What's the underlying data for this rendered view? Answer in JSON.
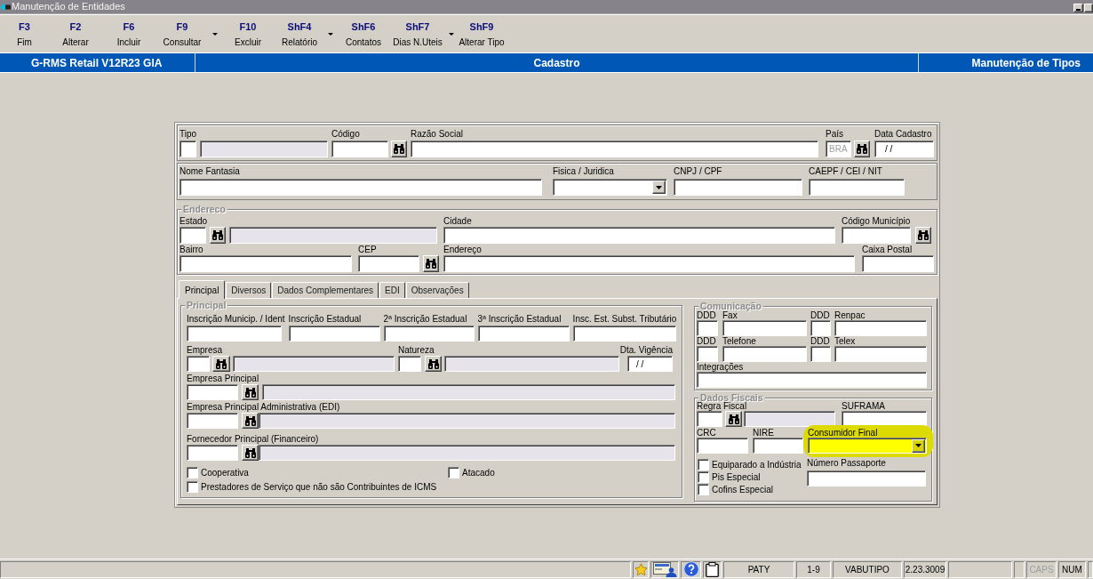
{
  "window": {
    "title": "Manutenção de Entidades"
  },
  "toolbar": [
    {
      "key": "F3",
      "label": "Fim",
      "menu": false
    },
    {
      "key": "F2",
      "label": "Alterar",
      "menu": false
    },
    {
      "key": "F6",
      "label": "Incluir",
      "menu": false
    },
    {
      "key": "F9",
      "label": "Consultar",
      "menu": true
    },
    {
      "key": "F10",
      "label": "Excluir",
      "menu": false
    },
    {
      "key": "ShF4",
      "label": "Relatório",
      "menu": true
    },
    {
      "key": "ShF6",
      "label": "Contatos",
      "menu": false
    },
    {
      "key": "ShF7",
      "label": "Dias N.Uteis",
      "menu": true
    },
    {
      "key": "ShF9",
      "label": "Alterar Tipo",
      "menu": false
    }
  ],
  "header_bar": {
    "system": "G-RMS Retail V12R23 GIA",
    "module": "Cadastro",
    "screen": "Manutenção de Tipos"
  },
  "identification": {
    "tipo": {
      "label": "Tipo"
    },
    "codigo": {
      "label": "Código"
    },
    "razao_social": {
      "label": "Razão Social"
    },
    "pais": {
      "label": "País",
      "value": "BRA",
      "disabled": true
    },
    "data_cadastro": {
      "label": "Data Cadastro",
      "value": "/ /"
    }
  },
  "details": {
    "nome_fantasia": {
      "label": "Nome Fantasia"
    },
    "fisica_juridica": {
      "label": "Fisica / Juridica"
    },
    "cnpj_cpf": {
      "label": "CNPJ / CPF"
    },
    "caepf_cei_nit": {
      "label": "CAEPF / CEI / NIT"
    }
  },
  "address": {
    "legend": "Endereco",
    "estado": {
      "label": "Estado"
    },
    "cidade": {
      "label": "Cidade"
    },
    "codigo_municipio": {
      "label": "Código Município"
    },
    "bairro": {
      "label": "Bairro"
    },
    "cep": {
      "label": "CEP"
    },
    "endereco": {
      "label": "Endereço"
    },
    "caixa_postal": {
      "label": "Caixa Postal"
    }
  },
  "tabs": [
    {
      "label": "Principal",
      "selected": true
    },
    {
      "label": "Diversos",
      "selected": false
    },
    {
      "label": "Dados Complementares",
      "selected": false
    },
    {
      "label": "EDI",
      "selected": false
    },
    {
      "label": "Observações",
      "selected": false
    }
  ],
  "principal": {
    "legend": "Principal",
    "inscricoes": [
      {
        "label": "Inscrição Municip. / Ident"
      },
      {
        "label": "Inscrição Estadual"
      },
      {
        "label": "2ª Inscrição Estadual"
      },
      {
        "label": "3ª Inscrição Estadual"
      },
      {
        "label": "Insc. Est. Subst. Tributário"
      }
    ],
    "empresa": {
      "label": "Empresa"
    },
    "natureza": {
      "label": "Natureza"
    },
    "dta_vigencia": {
      "label": "Dta. Vigência",
      "value": "/ /"
    },
    "empresa_principal": {
      "label": "Empresa Principal"
    },
    "empresa_principal_adm": {
      "label": "Empresa Principal Administrativa (EDI)"
    },
    "fornecedor_principal": {
      "label": "Fornecedor Principal (Financeiro)"
    },
    "checkboxes": [
      {
        "label": "Cooperativa",
        "checked": false
      },
      {
        "label": "Atacado",
        "checked": false
      },
      {
        "label": "Prestadores de Serviço que não são Contribuintes de ICMS",
        "checked": false
      }
    ]
  },
  "comunicacao": {
    "legend": "Comunicação",
    "ddd_fax": {
      "label": "DDD"
    },
    "fax": {
      "label": "Fax"
    },
    "ddd_renpac": {
      "label": "DDD"
    },
    "renpac": {
      "label": "Renpac"
    },
    "ddd_telefone": {
      "label": "DDD"
    },
    "telefone": {
      "label": "Telefone"
    },
    "ddd_telex": {
      "label": "DDD"
    },
    "telex": {
      "label": "Telex"
    },
    "integracoes": {
      "label": "Integrações"
    }
  },
  "dados_fiscais": {
    "legend": "Dados Fiscais",
    "regra_fiscal": {
      "label": "Regra Fiscal"
    },
    "suframa": {
      "label": "SUFRAMA"
    },
    "crc": {
      "label": "CRC"
    },
    "nire": {
      "label": "NIRE"
    },
    "consumidor_final": {
      "label": "Consumidor Final",
      "highlighted": true
    },
    "checkboxes": [
      {
        "label": "Equiparado a Indústria",
        "checked": false
      },
      {
        "label": "Pis Especial",
        "checked": false
      },
      {
        "label": "Cofins Especial",
        "checked": false
      }
    ],
    "numero_passaporte": {
      "label": "Número Passaporte"
    }
  },
  "status_bar": {
    "user": "PATY",
    "range": "1-9",
    "program": "VABUTIPO",
    "version": "2.23.3009",
    "indicators": [
      {
        "label": "CAPS",
        "on": false
      },
      {
        "label": "NUM",
        "on": true
      }
    ]
  }
}
